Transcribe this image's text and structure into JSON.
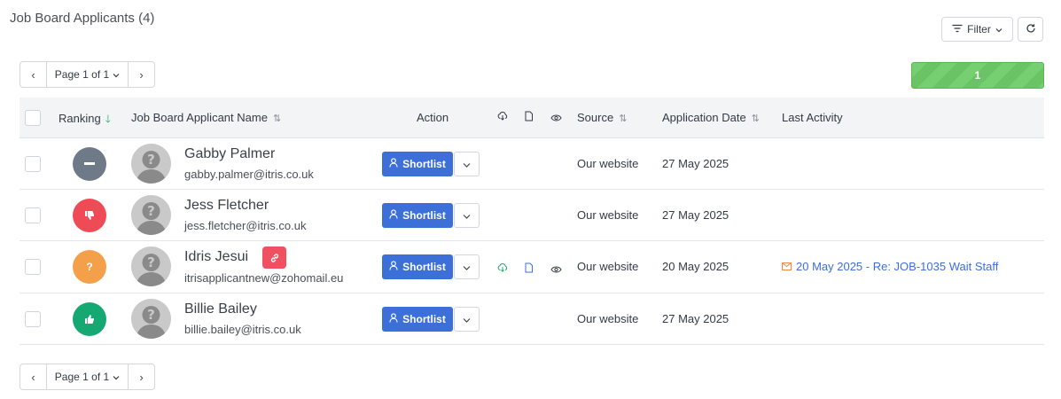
{
  "page": {
    "title": "Job Board Applicants (4)"
  },
  "toolbar": {
    "filter_label": "Filter"
  },
  "pagination": {
    "label": "Page 1 of 1"
  },
  "progress": {
    "value": "1",
    "fraction": 1.0
  },
  "table": {
    "headers": {
      "ranking": "Ranking",
      "name": "Job Board Applicant Name",
      "action": "Action",
      "source": "Source",
      "application_date": "Application Date",
      "last_activity": "Last Activity"
    },
    "rows": [
      {
        "name": "Gabby Palmer",
        "email": "gabby.palmer@itris.co.uk",
        "ranking": "neutral",
        "ranking_color": "#6f7a89",
        "action": "Shortlist",
        "source": "Our website",
        "application_date": "27 May 2025",
        "last_activity": ""
      },
      {
        "name": "Jess Fletcher",
        "email": "jess.fletcher@itris.co.uk",
        "ranking": "thumbs-down",
        "ranking_color": "#ef4b57",
        "action": "Shortlist",
        "source": "Our website",
        "application_date": "27 May 2025",
        "last_activity": ""
      },
      {
        "name": "Idris Jesui",
        "email": "itrisapplicantnew@zohomail.eu",
        "ranking": "unknown",
        "ranking_color": "#f4a04a",
        "action": "Shortlist",
        "source": "Our website",
        "application_date": "20 May 2025",
        "last_activity": "20 May 2025 - Re: JOB-1035 Wait Staff"
      },
      {
        "name": "Billie Bailey",
        "email": "billie.bailey@itris.co.uk",
        "ranking": "thumbs-up",
        "ranking_color": "#15a872",
        "action": "Shortlist",
        "source": "Our website",
        "application_date": "27 May 2025",
        "last_activity": ""
      }
    ]
  },
  "colors": {
    "primary": "#3c6fd8",
    "progress": "#6ac365",
    "header_bg": "#f2f4f6"
  }
}
